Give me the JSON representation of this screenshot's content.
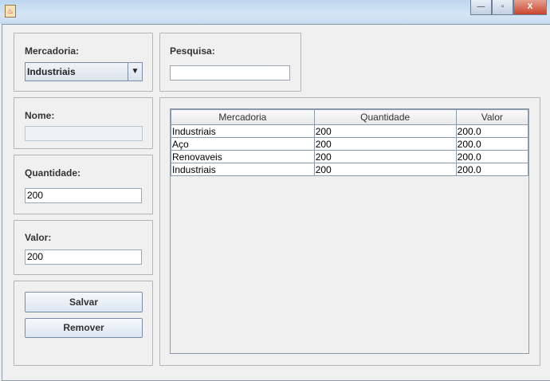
{
  "window": {
    "icon": "java-icon",
    "minimize": "—",
    "maximize": "▫",
    "close": "X"
  },
  "mercadoria": {
    "label": "Mercadoria:",
    "selected": "Industriais"
  },
  "pesquisa": {
    "label": "Pesquisa:",
    "value": ""
  },
  "nome": {
    "label": "Nome:",
    "value": ""
  },
  "quantidade": {
    "label": "Quantidade:",
    "value": "200"
  },
  "valor": {
    "label": "Valor:",
    "value": "200"
  },
  "buttons": {
    "salvar": "Salvar",
    "remover": "Remover"
  },
  "table": {
    "headers": [
      "Mercadoria",
      "Quantidade",
      "Valor"
    ],
    "rows": [
      [
        "Industriais",
        "200",
        "200.0"
      ],
      [
        "Aço",
        "200",
        "200.0"
      ],
      [
        "Renovaveis",
        "200",
        "200.0"
      ],
      [
        "Industriais",
        "200",
        "200.0"
      ]
    ]
  }
}
